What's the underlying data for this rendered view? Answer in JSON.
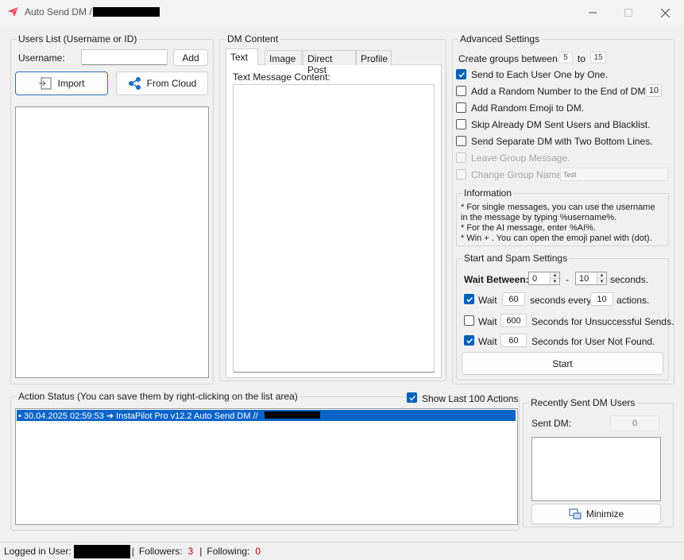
{
  "window": {
    "title": "Auto Send DM /",
    "icon": "paper-plane-icon",
    "accent": "#e9445a"
  },
  "users_list": {
    "legend": "Users List (Username or ID)",
    "username_label": "Username:",
    "username_value": "",
    "add_label": "Add",
    "import_label": "Import",
    "from_cloud_label": "From Cloud"
  },
  "dm_content": {
    "legend": "DM Content",
    "tabs": [
      "Text",
      "Image",
      "Direct Post",
      "Profile"
    ],
    "active_tab": "Text",
    "text_label": "Text Message Content:",
    "text_value": ""
  },
  "advanced": {
    "legend": "Advanced Settings",
    "groups_label": "Create groups between",
    "groups_from": "5",
    "groups_to_label": "to",
    "groups_to": "15",
    "options": [
      {
        "label": "Send to Each User One by One.",
        "checked": true,
        "disabled": false
      },
      {
        "label": "Add a Random Number to the End of DM:",
        "checked": false,
        "disabled": false
      },
      {
        "label": "Add Random Emoji to DM.",
        "checked": false,
        "disabled": false
      },
      {
        "label": "Skip Already DM Sent Users and Blacklist.",
        "checked": false,
        "disabled": false
      },
      {
        "label": "Send Separate DM  with Two Bottom Lines.",
        "checked": false,
        "disabled": false
      },
      {
        "label": "Leave Group Message.",
        "checked": false,
        "disabled": true
      },
      {
        "label": "Change Group Name:",
        "checked": false,
        "disabled": true
      }
    ],
    "random_number_value": "10",
    "group_name_value": "Test"
  },
  "information": {
    "legend": "Information",
    "lines": [
      "* For single messages, you can use the username",
      "in the message by typing %username%.",
      "* For the AI message, enter %AI%.",
      "* Win + . You can open the emoji panel with (dot)."
    ]
  },
  "spam": {
    "legend": "Start and Spam Settings",
    "wait_between_label": "Wait Between:",
    "wait_min": "0",
    "dash": "-",
    "wait_max": "10",
    "seconds_label": "seconds.",
    "rows": [
      {
        "checked": true,
        "wait_label": "Wait",
        "value": "60",
        "mid_label": "seconds every",
        "value2": "10",
        "end_label": "actions."
      },
      {
        "checked": false,
        "wait_label": "Wait",
        "value": "600",
        "end_label": "Seconds for Unsuccessful Sends."
      },
      {
        "checked": true,
        "wait_label": "Wait",
        "value": "60",
        "end_label": "Seconds for User Not Found."
      }
    ],
    "start_label": "Start"
  },
  "action_status": {
    "legend": "Action Status (You can save them by right-clicking on the list area)",
    "show_last_label": "Show Last 100 Actions",
    "show_last_checked": true,
    "entries": [
      "• 30.04.2025 02:59:53 ➔ InstaPilot Pro v12.2 Auto Send DM //"
    ]
  },
  "recent": {
    "legend": "Recently Sent DM Users",
    "sent_label": "Sent DM:",
    "sent_count": "0",
    "minimize_label": "Minimize"
  },
  "status_bar": {
    "logged_label": "Logged in User:",
    "sep1": "|",
    "followers_label": "Followers:",
    "followers_value": "3",
    "sep2": "|",
    "following_label": "Following:",
    "following_value": "0"
  }
}
